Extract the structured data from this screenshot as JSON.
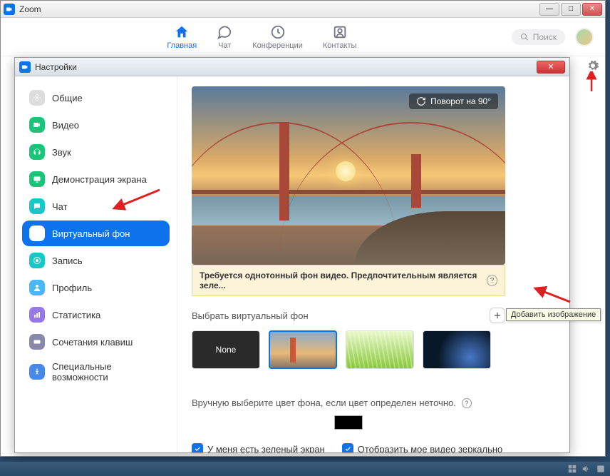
{
  "window": {
    "title": "Zoom"
  },
  "nav": {
    "home": "Главная",
    "chat": "Чат",
    "meetings": "Конференции",
    "contacts": "Контакты",
    "search_placeholder": "Поиск"
  },
  "settings": {
    "title": "Настройки",
    "sidebar": {
      "general": "Общие",
      "video": "Видео",
      "audio": "Звук",
      "share": "Демонстрация экрана",
      "chat": "Чат",
      "virtual_bg": "Виртуальный фон",
      "recording": "Запись",
      "profile": "Профиль",
      "stats": "Статистика",
      "shortcuts": "Сочетания клавиш",
      "accessibility": "Специальные возможности"
    },
    "preview": {
      "rotate_label": "Поворот на 90°"
    },
    "warning": "Требуется однотонный фон видео. Предпочтительным является зеле...",
    "choose_bg_label": "Выбрать виртуальный фон",
    "thumb_none": "None",
    "add_tooltip": "Добавить изображение",
    "manual_label": "Вручную выберите цвет фона, если цвет определен неточно.",
    "green_screen": "У меня есть зеленый экран",
    "mirror": "Отобразить мое видео зеркально"
  }
}
